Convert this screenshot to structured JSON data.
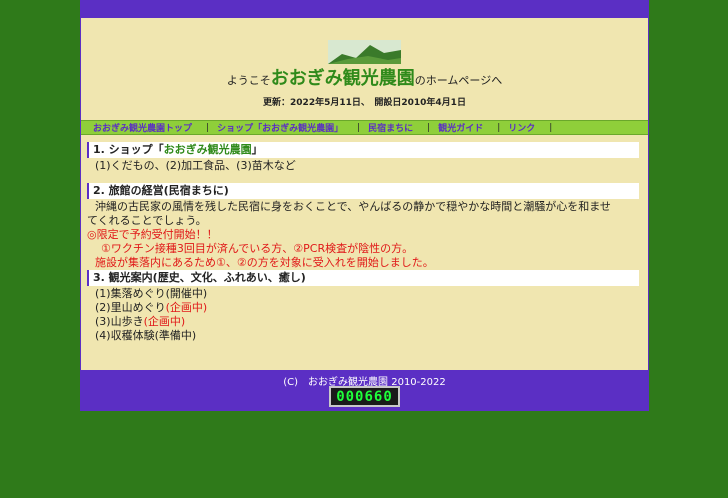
{
  "header": {
    "welcome_prefix": "ようこそ",
    "site_name": "おおぎみ観光農園",
    "welcome_suffix": "のホームページへ",
    "updated": "更新：2022年5月11日、　開設日2010年4月1日"
  },
  "nav": {
    "items": [
      {
        "label": "おおぎみ観光農園トップ"
      },
      {
        "label": "ショップ「おおぎみ観光農園」"
      },
      {
        "label": "民宿まちに"
      },
      {
        "label": "観光ガイド"
      },
      {
        "label": "リンク"
      }
    ],
    "separator": "|"
  },
  "sections": {
    "shop": {
      "heading_prefix": "1. ショップ「",
      "heading_name": "おおぎみ観光農園",
      "heading_suffix": "」",
      "line1": "(1)くだもの、(2)加工食品、(3)苗木など"
    },
    "inn": {
      "heading": "2. 旅館の経営(民宿まちに)",
      "line1": "沖縄の古民家の風情を残した民宿に身をおくことで、やんばるの静かで穏やかな時間と潮騒が心を和ませ",
      "line2": "てくれることでしょう。",
      "notice1": "◎限定で予約受付開始！！",
      "notice2": "①ワクチン接種3回目が済んでいる方、②PCR検査が陰性の方。",
      "notice3": "施設が集落内にあるため①、②の方を対象に受入れを開始しました。"
    },
    "tour": {
      "heading": "3. 観光案内(歴史、文化、ふれあい、癒し)",
      "item1": "(1)集落めぐり(開催中)",
      "item2_text": "(2)里山めぐり",
      "item2_status": "(企画中)",
      "item3_text": "(3)山歩き",
      "item3_status": "(企画中)",
      "item4": "(4)収穫体験(準備中)"
    }
  },
  "footer": {
    "copyright": "(C)　おおぎみ観光農園 2010-2022",
    "counter": "000660"
  },
  "colors": {
    "background": "#2f7a1a",
    "accent": "#5b2fc4",
    "panel": "#f0e6b0",
    "nav": "#8fcf3a",
    "highlight_red": "#e01818"
  }
}
